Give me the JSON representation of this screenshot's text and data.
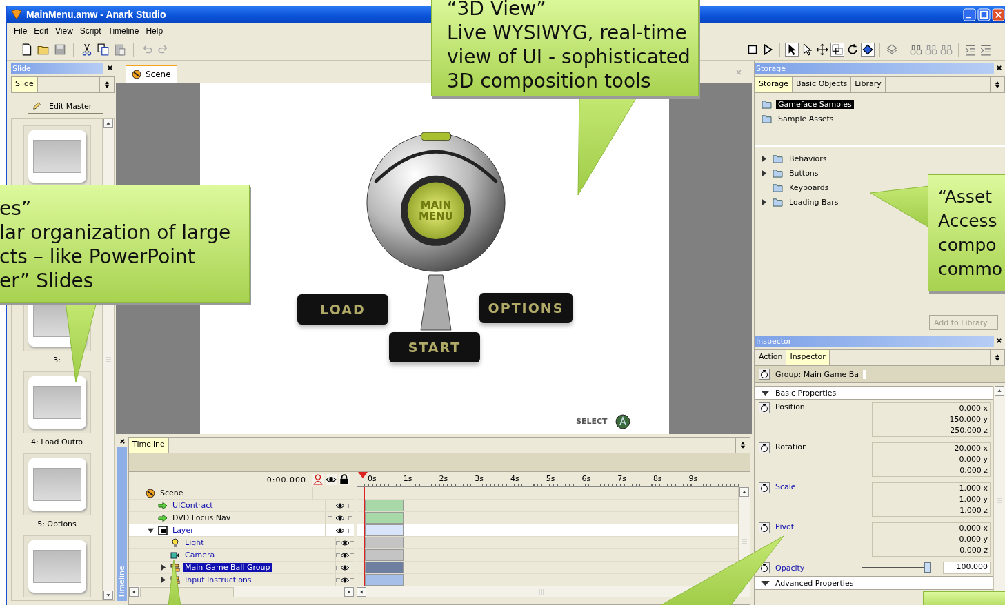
{
  "window": {
    "title": "MainMenu.amw - Anark Studio"
  },
  "menu": [
    "File",
    "Edit",
    "View",
    "Script",
    "Timeline",
    "Help"
  ],
  "slide_panel": {
    "title": "Slide",
    "tabs": [
      {
        "label": "Slide",
        "selected": true
      }
    ],
    "edit_master": "Edit Master",
    "slides": [
      {
        "label": "3:"
      },
      {
        "label": "4: Load Outro"
      },
      {
        "label": "5: Options"
      }
    ]
  },
  "scene_tab": {
    "label": "Scene",
    "selected": true
  },
  "viewport": {
    "orb_label": "MAIN MENU",
    "buttons": [
      "LOAD",
      "OPTIONS",
      "START"
    ],
    "hint": "SELECT"
  },
  "timeline": {
    "side_label": "Timeline",
    "tabs": [
      {
        "label": "Timeline",
        "selected": true
      }
    ],
    "time": "0:00.000",
    "ruler": [
      "0s",
      "1s",
      "2s",
      "3s",
      "4s",
      "5s",
      "6s",
      "7s",
      "8s",
      "9s"
    ],
    "rows": [
      {
        "name": "Scene",
        "kind": "scene",
        "color": "#000000",
        "selected": false,
        "children": [
          {
            "name": "UIContract",
            "kind": "behavior",
            "color": "#1010b0",
            "selected": false,
            "visible": true,
            "solo": false,
            "locked": false
          },
          {
            "name": "DVD Focus Nav",
            "kind": "behavior",
            "color": "#000000",
            "selected": false,
            "visible": true,
            "solo": false,
            "locked": false
          },
          {
            "name": "Layer",
            "kind": "layer",
            "color": "#1010b0",
            "selected": false,
            "visible": true,
            "solo": false,
            "locked": false,
            "expanded": true,
            "children": [
              {
                "name": "Light",
                "kind": "light",
                "color": "#1010b0",
                "selected": false,
                "visible": true,
                "solo": false,
                "locked": false
              },
              {
                "name": "Camera",
                "kind": "camera",
                "color": "#1010b0",
                "selected": false,
                "visible": true,
                "solo": false,
                "locked": false
              },
              {
                "name": "Main Game Ball Group",
                "kind": "group",
                "color": "#1010b0",
                "selected": true,
                "visible": true,
                "solo": false,
                "locked": false,
                "expanded": false
              },
              {
                "name": "Input Instructions",
                "kind": "group",
                "color": "#1010b0",
                "selected": false,
                "visible": true,
                "solo": false,
                "locked": false,
                "expanded": false
              }
            ]
          }
        ]
      }
    ]
  },
  "storage": {
    "title": "Storage",
    "tabs": [
      {
        "label": "Storage",
        "selected": true
      },
      {
        "label": "Basic Objects",
        "selected": false
      },
      {
        "label": "Library",
        "selected": false
      }
    ],
    "folders": [
      {
        "name": "Gameface Samples",
        "selected": true
      },
      {
        "name": "Sample Assets",
        "selected": false
      }
    ],
    "library": [
      {
        "name": "Behaviors",
        "expandable": true
      },
      {
        "name": "Buttons",
        "expandable": true
      },
      {
        "name": "Keyboards",
        "expandable": false
      },
      {
        "name": "Loading Bars",
        "expandable": true
      }
    ],
    "add_button": {
      "label": "Add to Library",
      "disabled": true
    }
  },
  "inspector": {
    "title": "Inspector",
    "tabs": [
      {
        "label": "Action",
        "selected": false
      },
      {
        "label": "Inspector",
        "selected": true
      }
    ],
    "object": "Group: Main Game Ba",
    "sections": [
      {
        "title": "Basic Properties",
        "expanded": true,
        "properties": [
          {
            "kind": "vector",
            "label": "Position",
            "color": "#000000",
            "values": [
              "0.000 x",
              "150.000 y",
              "250.000 z"
            ]
          },
          {
            "kind": "vector",
            "label": "Rotation",
            "color": "#000000",
            "values": [
              "-20.000 x",
              "0.000 y",
              "0.000 z"
            ]
          },
          {
            "kind": "vector",
            "label": "Scale",
            "color": "#1010b0",
            "values": [
              "1.000 x",
              "1.000 y",
              "1.000 z"
            ]
          },
          {
            "kind": "vector",
            "label": "Pivot",
            "color": "#1010b0",
            "values": [
              "0.000 x",
              "0.000 y",
              "0.000 z"
            ]
          },
          {
            "kind": "slider",
            "label": "Opacity",
            "color": "#1010b0",
            "level": 1,
            "value": "100.000"
          }
        ]
      },
      {
        "title": "Advanced Properties",
        "expanded": true
      }
    ]
  },
  "callouts": [
    {
      "kind": "view",
      "lines": [
        "“3D View”",
        "Live WYSIWYG, real-time",
        "view of UI - sophisticated",
        "3D composition tools"
      ]
    },
    {
      "kind": "slides",
      "lines": [
        "es”",
        "lar organization of large",
        "cts – like PowerPoint",
        "er” Slides"
      ]
    },
    {
      "kind": "assets",
      "lines": [
        "“Asset",
        "Access",
        "compo",
        "commo"
      ]
    }
  ]
}
